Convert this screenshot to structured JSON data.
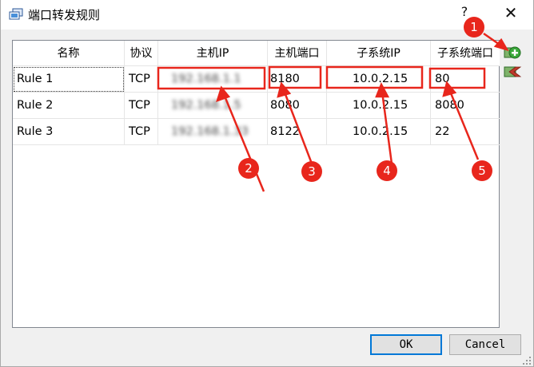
{
  "window": {
    "title": "端口转发规则",
    "help": "?",
    "close": "✕"
  },
  "table": {
    "headers": [
      "名称",
      "协议",
      "主机IP",
      "主机端口",
      "子系统IP",
      "子系统端口"
    ],
    "rows": [
      {
        "name": "Rule 1",
        "protocol": "TCP",
        "host_ip": "192.168.1.1",
        "host_port": "8180",
        "guest_ip": "10.0.2.15",
        "guest_port": "80"
      },
      {
        "name": "Rule 2",
        "protocol": "TCP",
        "host_ip": "192.168.1.5",
        "host_port": "8080",
        "guest_ip": "10.0.2.15",
        "guest_port": "8080"
      },
      {
        "name": "Rule 3",
        "protocol": "TCP",
        "host_ip": "192.168.1.33",
        "host_port": "8122",
        "guest_ip": "10.0.2.15",
        "guest_port": "22"
      }
    ]
  },
  "buttons": {
    "ok": "OK",
    "cancel": "Cancel"
  },
  "side": {
    "add_icon": "add-rule-icon",
    "remove_icon": "remove-rule-icon"
  },
  "annotations": [
    "1",
    "2",
    "3",
    "4",
    "5"
  ],
  "colors": {
    "annotation": "#e8261c",
    "accent": "#0078d7",
    "add": "#3aa83a"
  }
}
